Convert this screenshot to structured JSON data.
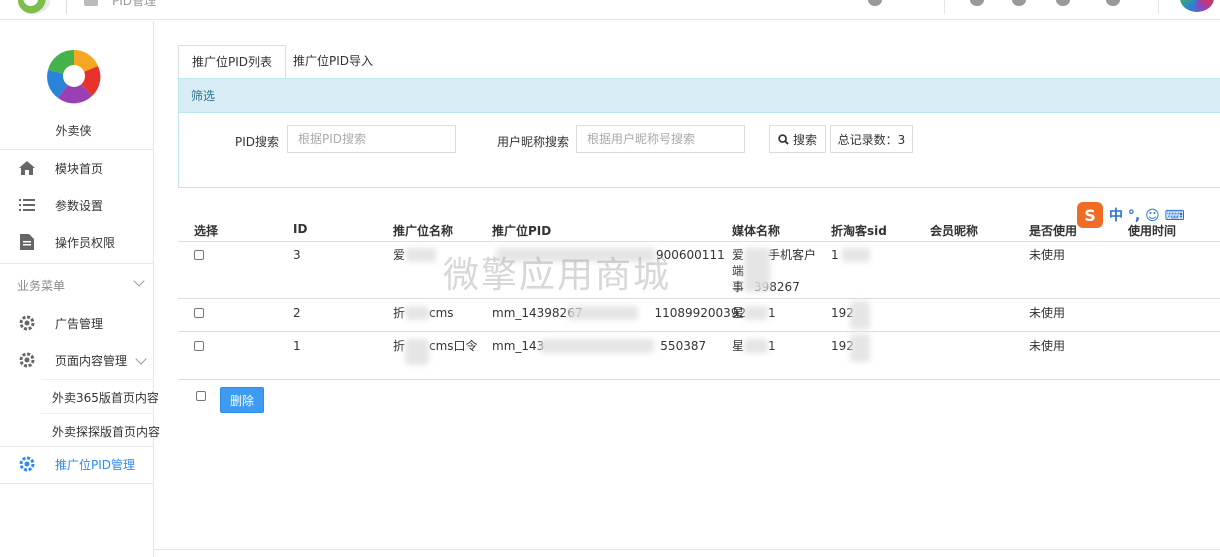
{
  "topbar": {
    "breadcrumb": "PID管理",
    "ime_text": "中 °, ☺ ⌨"
  },
  "sidebar": {
    "app_name": "外卖侠",
    "items": [
      {
        "label": "模块首页",
        "icon": "home-icon"
      },
      {
        "label": "参数设置",
        "icon": "list-icon"
      },
      {
        "label": "操作员权限",
        "icon": "document-icon"
      }
    ],
    "group_label": "业务菜单",
    "biz_items": [
      {
        "label": "广告管理",
        "icon": "gear-icon"
      },
      {
        "label": "页面内容管理",
        "icon": "gear-icon"
      }
    ],
    "sub_items": [
      "外卖365版首页内容",
      "外卖探探版首页内容"
    ],
    "active_item": {
      "label": "推广位PID管理",
      "icon": "gear-icon"
    }
  },
  "tabs": [
    {
      "label": "推广位PID列表",
      "active": true
    },
    {
      "label": "推广位PID导入",
      "active": false
    }
  ],
  "filter": {
    "title": "筛选",
    "pid_label": "PID搜索",
    "pid_placeholder": "根据PID搜索",
    "nick_label": "用户昵称搜索",
    "nick_placeholder": "根据用户昵称号搜索",
    "search_button": "搜索",
    "total_label": "总记录数：3"
  },
  "table": {
    "headers": [
      "选择",
      "ID",
      "推广位名称",
      "推广位PID",
      "媒体名称",
      "折淘客sid",
      "会员昵称",
      "是否使用",
      "使用时间"
    ],
    "rows": [
      {
        "id": "3",
        "name": "爱",
        "pid": "900600111",
        "media": "手机客户",
        "media2": "端",
        "media3": "398267",
        "sid": "1",
        "nick": "",
        "used": "未使用",
        "time": ""
      },
      {
        "id": "2",
        "name": "折",
        "name_suffix": "cms",
        "pid": "mm_14398267",
        "pid_suffix": "110899200392",
        "media": "星",
        "media_suffix": "1",
        "sid": "192",
        "nick": "",
        "used": "未使用",
        "time": ""
      },
      {
        "id": "1",
        "name": "折",
        "name_suffix": "cms口令",
        "pid": "mm_143",
        "pid_suffix": "550387",
        "media": "星",
        "media_suffix": "1",
        "sid": "192",
        "nick": "",
        "used": "未使用",
        "time": ""
      }
    ]
  },
  "actions": {
    "delete_button": "删除"
  },
  "watermark": "微擎应用商城",
  "colors": {
    "primary": "#3d9bf2",
    "active_text": "#2c8af2",
    "panel_head": "#d9edf7",
    "panel_border": "#bce8f1"
  }
}
